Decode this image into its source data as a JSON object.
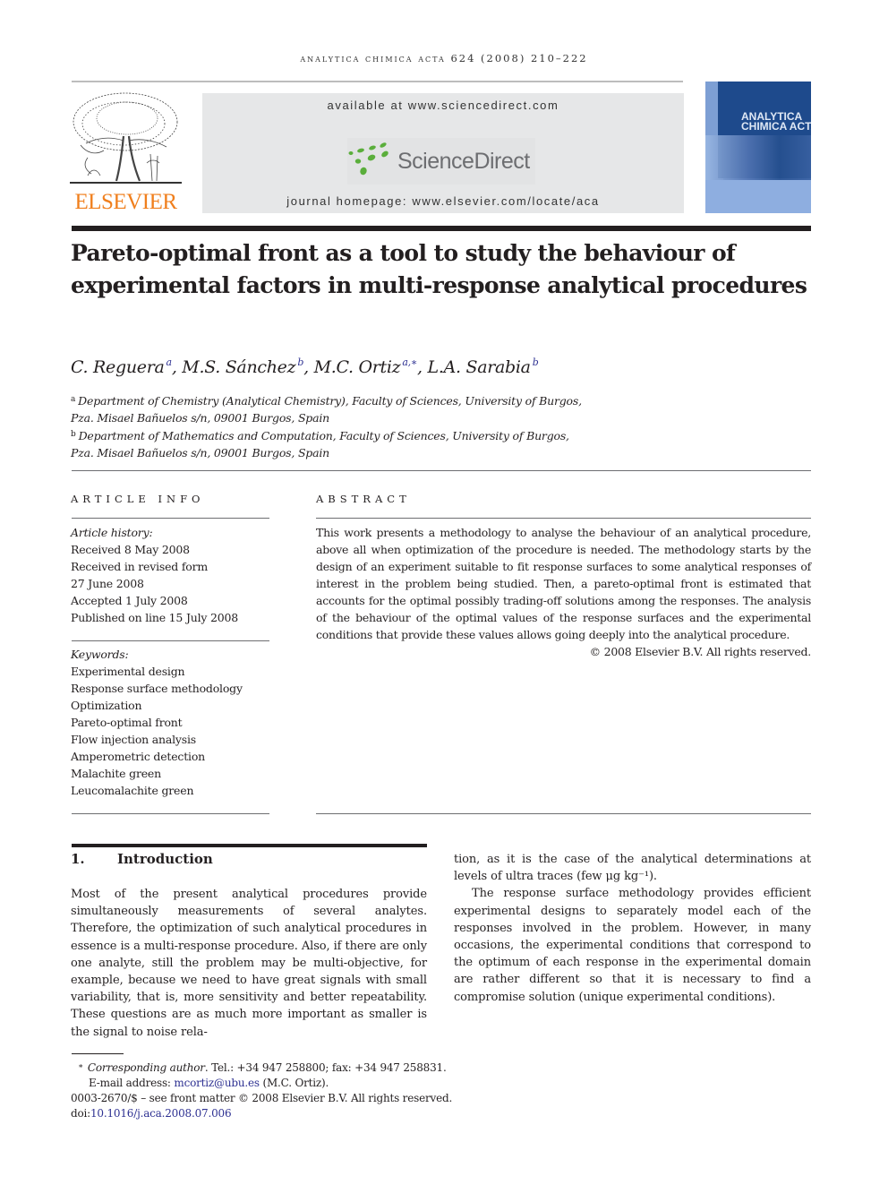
{
  "running_head": "ANALYTICA CHIMICA ACTA 624 (2008) 210–222",
  "header": {
    "publisher_logo_text": "ELSEVIER",
    "available_at": "available at www.sciencedirect.com",
    "sciencedirect_logo_text": "ScienceDirect",
    "journal_homepage": "journal homepage: www.elsevier.com/locate/aca",
    "cover_title_line1": "ANALYTICA",
    "cover_title_line2": "CHIMICA ACTA",
    "colors": {
      "elsevier_orange": "#f07f1d",
      "sd_green": "#5aae3b",
      "sd_gray": "#6d6e71",
      "cover_blue": "#1e4a8c",
      "link_blue": "#2e3192"
    }
  },
  "article": {
    "title": "Pareto-optimal front as a tool to study the behaviour of experimental factors in multi-response analytical procedures",
    "authors": [
      {
        "name": "C. Reguera",
        "sup": "a"
      },
      {
        "name": "M.S. Sánchez",
        "sup": "b"
      },
      {
        "name": "M.C. Ortiz",
        "sup": "a,∗"
      },
      {
        "name": "L.A. Sarabia",
        "sup": "b"
      }
    ],
    "affiliations": [
      {
        "sup": "a",
        "line1": "Department of Chemistry (Analytical Chemistry), Faculty of Sciences, University of Burgos,",
        "line2": "Pza. Misael Bañuelos s/n, 09001 Burgos, Spain"
      },
      {
        "sup": "b",
        "line1": "Department of Mathematics and Computation, Faculty of Sciences, University of Burgos,",
        "line2": "Pza. Misael Bañuelos s/n, 09001 Burgos, Spain"
      }
    ]
  },
  "article_info": {
    "heading": "ARTICLE INFO",
    "history_label": "Article history:",
    "history": [
      "Received 8 May 2008",
      "Received in revised form",
      "27 June 2008",
      "Accepted 1 July 2008",
      "Published on line 15 July 2008"
    ],
    "keywords_label": "Keywords:",
    "keywords": [
      "Experimental design",
      "Response surface methodology",
      "Optimization",
      "Pareto-optimal front",
      "Flow injection analysis",
      "Amperometric detection",
      "Malachite green",
      "Leucomalachite green"
    ]
  },
  "abstract": {
    "heading": "ABSTRACT",
    "text": "This work presents a methodology to analyse the behaviour of an analytical procedure, above all when optimization of the procedure is needed. The methodology starts by the design of an experiment suitable to fit response surfaces to some analytical responses of interest in the problem being studied. Then, a pareto-optimal front is estimated that accounts for the optimal possibly trading-off solutions among the responses. The analysis of the behaviour of the optimal values of the response surfaces and the experimental conditions that provide these values allows going deeply into the analytical procedure.",
    "copyright": "© 2008 Elsevier B.V. All rights reserved."
  },
  "introduction": {
    "number": "1.",
    "heading": "Introduction",
    "col1_p1": "Most of the present analytical procedures provide simultaneously measurements of several analytes. Therefore, the optimization of such analytical procedures in essence is a multi-response procedure. Also, if there are only one analyte, still the problem may be multi-objective, for example, because we need to have great signals with small variability, that is, more sensitivity and better repeatability. These questions are as much more important as smaller is the signal to noise rela-",
    "col2_p1": "tion, as it is the case of the analytical determinations at levels of ultra traces (few μg kg⁻¹).",
    "col2_p2": "The response surface methodology provides efficient experimental designs to separately model each of the responses involved in the problem. However, in many occasions, the experimental conditions that correspond to the optimum of each response in the experimental domain are rather different so that it is necessary to find a compromise solution (unique experimental conditions)."
  },
  "footnotes": {
    "star": "∗",
    "corresponding_label": "Corresponding author",
    "contact": ". Tel.: +34 947 258800; fax: +34 947 258831.",
    "email_label": "E-mail address: ",
    "email": "mcortiz@ubu.es",
    "email_suffix": " (M.C. Ortiz).",
    "front_matter": "0003-2670/$ – see front matter © 2008 Elsevier B.V. All rights reserved.",
    "doi_label": "doi:",
    "doi": "10.1016/j.aca.2008.07.006"
  }
}
